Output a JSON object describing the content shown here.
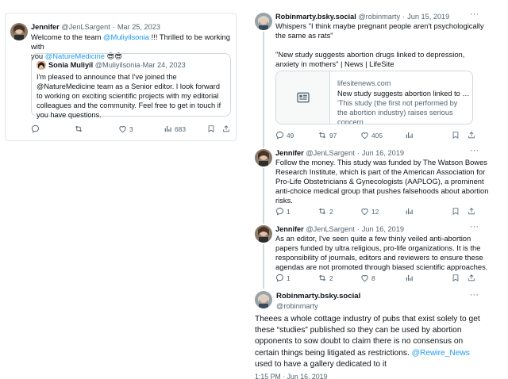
{
  "left": {
    "tweet": {
      "name": "Jennifer",
      "handle": "@JenLSargent",
      "date": "Mar 25, 2023",
      "text_pre": "Welcome to the team ",
      "mention": "@Muliyilsonia",
      "text_mid": " !!! Thrilled to be working with",
      "text_line2_pre": "you ",
      "mention2": "@NatureMedicine",
      "emoji": "😎😎"
    },
    "quote": {
      "name": "Sonia Muliyil",
      "handle": "@Muliyilsonia",
      "date": "Mar 24, 2023",
      "text": "I'm pleased to announce that I've joined the @NatureMedicine team as a Senior editor. I look forward to working on exciting scientific projects with my editorial colleagues and the community. Feel free to get in touch if you have questions."
    },
    "actions": {
      "replies": "",
      "retweets": "",
      "likes": "3",
      "views": "683"
    }
  },
  "right": {
    "tweets": [
      {
        "name": "Robinmarty.bsky.social",
        "handle": "@robinmarty",
        "date": "Jun 15, 2019",
        "text1": "Whispers \"I think maybe pregnant people aren't psychologically the same as rats\"",
        "text2": "\"New study suggests abortion drugs linked to depression, anxiety in mothers\" | News | LifeSite",
        "card": {
          "domain": "lifesitenews.com",
          "title": "New study suggests abortion linked to depr",
          "desc": "'This study (the first not performed by the abortion industry) raises serious concern..."
        },
        "actions": {
          "replies": "49",
          "retweets": "97",
          "likes": "405",
          "views": ""
        }
      },
      {
        "name": "Jennifer",
        "handle": "@JenLSargent",
        "date": "Jun 16, 2019",
        "text": "Follow the money. This study was funded by The Watson Bowes Research Institute, which is part of the American Association for Pro-Life Obstetricians & Gynecologists (AAPLOG), a prominent anti-choice medical group that pushes falsehoods about abortion risks.",
        "actions": {
          "replies": "1",
          "retweets": "2",
          "likes": "12",
          "views": ""
        }
      },
      {
        "name": "Jennifer",
        "handle": "@JenLSargent",
        "date": "Jun 16, 2019",
        "text": "As an editor, I've seen quite a few thinly veiled anti-abortion papers funded by ultra religious, pro-life organizations. It is the responsibility of journals, editors and reviewers to ensure these agendas are not promoted through biased scientific approaches.",
        "actions": {
          "replies": "1",
          "retweets": "2",
          "likes": "8",
          "views": ""
        }
      }
    ],
    "main": {
      "name": "Robinmarty.bsky.social",
      "handle": "@robinmarty",
      "text_pre": "Theees a whole cottage industry of pubs that exist solely to get these “studies” published so they can be used by abortion opponents to sow doubt to claim there is no consensus on certain things being litigated as restrictions. ",
      "mention": "@Rewire_News",
      "text_post": " used to have a gallery dedicated to it",
      "timestamp": "1:15 PM · Jun 16, 2019"
    },
    "more_label": "···"
  },
  "icons": [
    "reply-icon",
    "retweet-icon",
    "like-icon",
    "views-icon",
    "bookmark-icon",
    "share-icon",
    "article-icon",
    "more-icon"
  ],
  "colors": {
    "link": "#1d9bf0",
    "muted": "#536471",
    "border": "#cfd9de",
    "text": "#0f1419"
  }
}
